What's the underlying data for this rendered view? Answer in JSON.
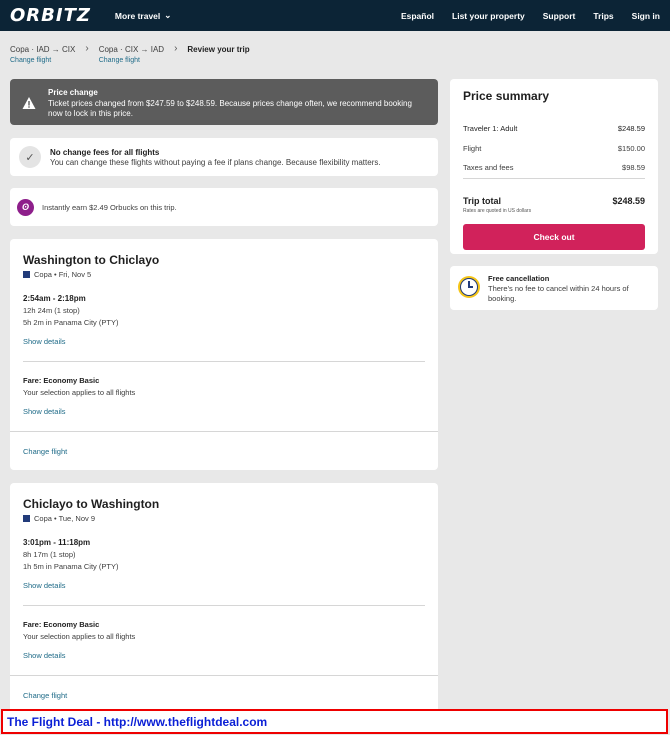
{
  "header": {
    "logo": "ORBITZ",
    "more_travel": "More travel",
    "nav": [
      "Español",
      "List your property",
      "Support",
      "Trips",
      "Sign in"
    ]
  },
  "breadcrumbs": [
    {
      "title": "Copa · IAD → CIX",
      "link": "Change flight"
    },
    {
      "title": "Copa · CIX → IAD",
      "link": "Change flight"
    },
    {
      "title": "Review your trip",
      "link": ""
    }
  ],
  "alert": {
    "title": "Price change",
    "message": "Ticket prices changed from $247.59 to $248.59. Because prices change often, we recommend booking now to lock in this price."
  },
  "no_change": {
    "title": "No change fees for all flights",
    "message": "You can change these flights without paying a fee if plans change. Because flexibility matters."
  },
  "orbucks": {
    "message": "Instantly earn $2.49 Orbucks on this trip."
  },
  "flights": [
    {
      "route": "Washington to Chiclayo",
      "airline": "Copa • Fri, Nov 5",
      "times": "2:54am - 2:18pm",
      "duration": "12h 24m (1 stop)",
      "layover": "5h 2m in Panama City (PTY)",
      "show_details": "Show details",
      "fare": "Fare: Economy Basic",
      "fare_note": "Your selection applies to all flights",
      "fare_details": "Show details",
      "change": "Change flight"
    },
    {
      "route": "Chiclayo to Washington",
      "airline": "Copa • Tue, Nov 9",
      "times": "3:01pm - 11:18pm",
      "duration": "8h 17m (1 stop)",
      "layover": "1h 5m in Panama City (PTY)",
      "show_details": "Show details",
      "fare": "Fare: Economy Basic",
      "fare_note": "Your selection applies to all flights",
      "fare_details": "Show details",
      "change": "Change flight"
    }
  ],
  "summary": {
    "title": "Price summary",
    "traveler_label": "Traveler 1: Adult",
    "traveler_value": "$248.59",
    "flight_label": "Flight",
    "flight_value": "$150.00",
    "taxes_label": "Taxes and fees",
    "taxes_value": "$98.59",
    "total_label": "Trip total",
    "total_value": "$248.59",
    "rates_note": "Rates are quoted in US dollars",
    "checkout": "Check out"
  },
  "free_cancel": {
    "title": "Free cancellation",
    "message": "There's no fee to cancel within 24 hours of booking."
  },
  "banner": {
    "text": "The Flight Deal - http://www.theflightdeal.com"
  },
  "colors": {
    "topbar": "#0c2436",
    "checkout": "#d1225b",
    "link": "#1f6b88",
    "alert": "#5c5c5c",
    "orbucks": "#8e1f8b",
    "banner_text": "#0a1fd6",
    "banner_border": "#ee0000"
  }
}
